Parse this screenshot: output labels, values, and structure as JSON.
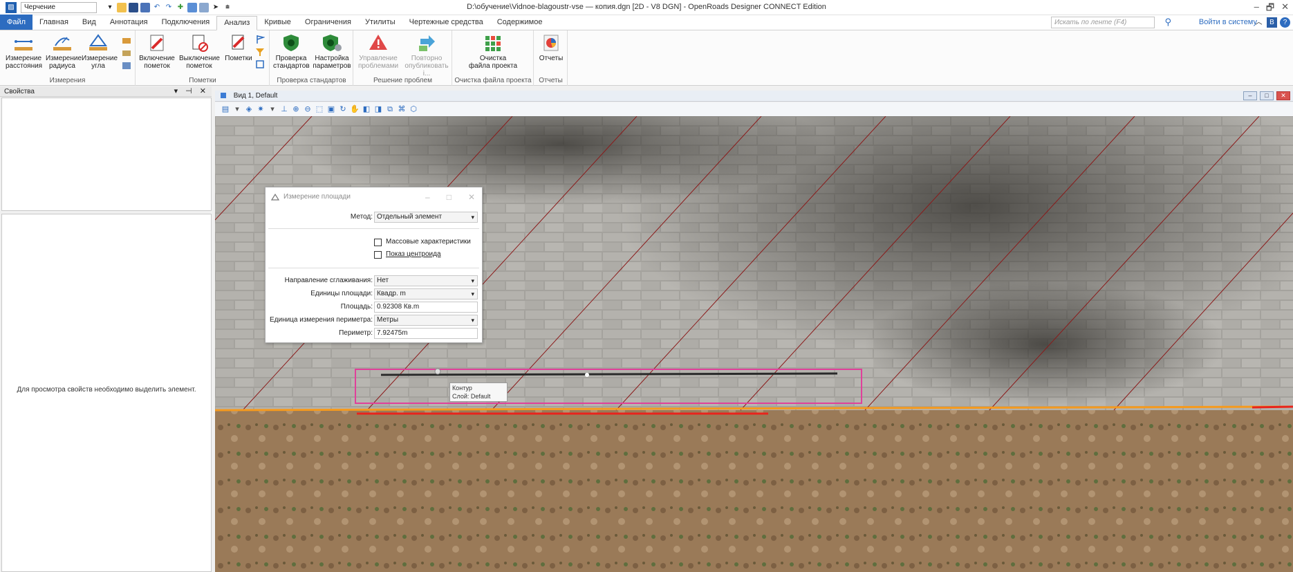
{
  "titlebar": {
    "workflow": "Черчение",
    "window_title": "D:\\обучение\\Vidnoe-blagoustr-vse — копия.dgn [2D - V8 DGN] - OpenRoads Designer CONNECT Edition",
    "minimize": "–",
    "maximize": "🗗",
    "close": "✕"
  },
  "tabs": [
    "Файл",
    "Главная",
    "Вид",
    "Аннотация",
    "Подключения",
    "Анализ",
    "Кривые",
    "Ограничения",
    "Утилиты",
    "Чертежные средства",
    "Содержимое"
  ],
  "active_tab": "Анализ",
  "search": {
    "placeholder": "Искать по ленте (F4)"
  },
  "sign_in": "Войти в систему",
  "ribbon": {
    "measure_distance": "Измерение\nрасстояния",
    "measure_radius": "Измерение\nрадиуса",
    "measure_angle": "Измерение\nугла",
    "measure_group": "Измерения",
    "markup_on": "Включение\nпометок",
    "markup_off": "Выключение\nпометок",
    "markups": "Пометки",
    "markup_group": "Пометки",
    "check_standards": "Проверка\nстандартов",
    "setup_params": "Настройка\nпараметров",
    "standards_group": "Проверка стандартов",
    "manage_problems": "Управление\nпроблемами",
    "republish": "Повторно\nопубликовать і...",
    "problems_group": "Решение проблем",
    "cleanup_file": "Очистка\nфайла проекта",
    "cleanup_group": "Очистка файла проекта",
    "reports": "Отчеты",
    "reports_group": "Отчеты"
  },
  "properties": {
    "title": "Свойства",
    "controls": "▾ ⊣ ✕",
    "empty_message": "Для просмотра свойств необходимо выделить элемент."
  },
  "view": {
    "title": "Вид 1, Default"
  },
  "dialog": {
    "title": "Измерение площади",
    "method_label": "Метод:",
    "method_value": "Отдельный элемент",
    "mass_props": "Массовые характеристики",
    "show_centroid": "Показ центроида",
    "smoothing_label": "Направление сглаживания:",
    "smoothing_value": "Нет",
    "area_units_label": "Единицы площади:",
    "area_units_value": "Квадр. m",
    "area_label": "Площадь:",
    "area_value": "0.92308  Кв.m",
    "perimeter_units_label": "Единица измерения периметра:",
    "perimeter_units_value": "Метры",
    "perimeter_label": "Периметр:",
    "perimeter_value": "7.92475m"
  },
  "tooltip": {
    "line1": "Контур",
    "line2": "Слой: Default"
  },
  "colors": {
    "accent": "#2d6cc0",
    "pink_contour": "#e0409a",
    "orange_line": "#f59a1e",
    "red_line": "#e8241c",
    "diagonal_lines": "#8b1a1a"
  }
}
